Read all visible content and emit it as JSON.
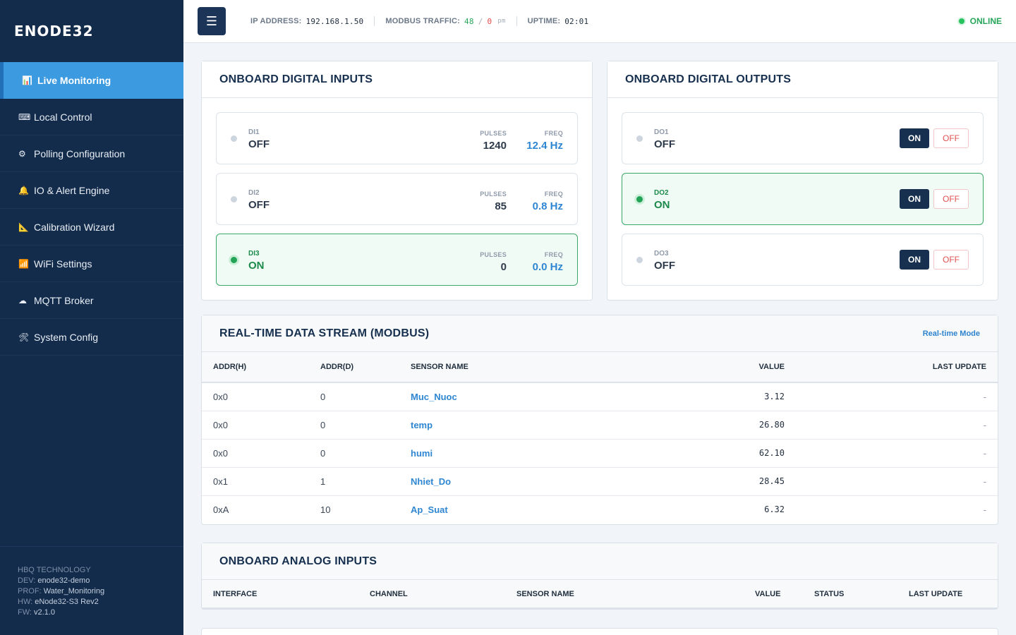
{
  "sidebar": {
    "brand": "ENODE32",
    "items": [
      {
        "icon": "📊",
        "label": "Live Monitoring"
      },
      {
        "icon": "⌨",
        "label": "Local Control"
      },
      {
        "icon": "⚙",
        "label": "Polling Configuration"
      },
      {
        "icon": "🔔",
        "label": "IO & Alert Engine"
      },
      {
        "icon": "📐",
        "label": "Calibration Wizard"
      },
      {
        "icon": "📶",
        "label": "WiFi Settings"
      },
      {
        "icon": "☁",
        "label": "MQTT Broker"
      },
      {
        "icon": "🛠",
        "label": "System Config"
      }
    ],
    "footer": {
      "company": "HBQ TECHNOLOGY",
      "dev_label": "DEV:",
      "dev": "enode32-demo",
      "prof_label": "PROF:",
      "prof": "Water_Monitoring",
      "hw_label": "HW:",
      "hw": "eNode32-S3 Rev2",
      "fw_label": "FW:",
      "fw": "v2.1.0"
    }
  },
  "topbar": {
    "menu_icon": "☰",
    "ip_label": "IP ADDRESS:",
    "ip": "192.168.1.50",
    "traffic_label": "MODBUS TRAFFIC:",
    "traffic_ok": "48",
    "traffic_slash": "/",
    "traffic_err": "0",
    "traffic_unit": "pm",
    "uptime_label": "UPTIME:",
    "uptime": "02:01",
    "status": "ONLINE"
  },
  "digital_inputs": {
    "title": "ONBOARD DIGITAL INPUTS",
    "pulses_label": "PULSES",
    "freq_label": "FREQ",
    "items": [
      {
        "name": "DI1",
        "state": "OFF",
        "pulses": "1240",
        "freq": "12.4 Hz"
      },
      {
        "name": "DI2",
        "state": "OFF",
        "pulses": "85",
        "freq": "0.8 Hz"
      },
      {
        "name": "DI3",
        "state": "ON",
        "pulses": "0",
        "freq": "0.0 Hz"
      }
    ]
  },
  "digital_outputs": {
    "title": "ONBOARD DIGITAL OUTPUTS",
    "on_label": "ON",
    "off_label": "OFF",
    "items": [
      {
        "name": "DO1",
        "state": "OFF"
      },
      {
        "name": "DO2",
        "state": "ON"
      },
      {
        "name": "DO3",
        "state": "OFF"
      }
    ]
  },
  "modbus": {
    "title": "REAL-TIME DATA STREAM (MODBUS)",
    "mode": "Real-time Mode",
    "columns": [
      "ADDR(H)",
      "ADDR(D)",
      "SENSOR NAME",
      "VALUE",
      "LAST UPDATE"
    ],
    "rows": [
      {
        "hex": "0x0",
        "dec": "0",
        "sensor": "Muc_Nuoc",
        "value": "3.12",
        "updated": "-"
      },
      {
        "hex": "0x0",
        "dec": "0",
        "sensor": "temp",
        "value": "26.80",
        "updated": "-"
      },
      {
        "hex": "0x0",
        "dec": "0",
        "sensor": "humi",
        "value": "62.10",
        "updated": "-"
      },
      {
        "hex": "0x1",
        "dec": "1",
        "sensor": "Nhiet_Do",
        "value": "28.45",
        "updated": "-"
      },
      {
        "hex": "0xA",
        "dec": "10",
        "sensor": "Ap_Suat",
        "value": "6.32",
        "updated": "-"
      }
    ]
  },
  "analog": {
    "title": "ONBOARD ANALOG INPUTS",
    "columns": [
      "INTERFACE",
      "CHANNEL",
      "SENSOR NAME",
      "VALUE",
      "STATUS",
      "LAST UPDATE"
    ]
  }
}
